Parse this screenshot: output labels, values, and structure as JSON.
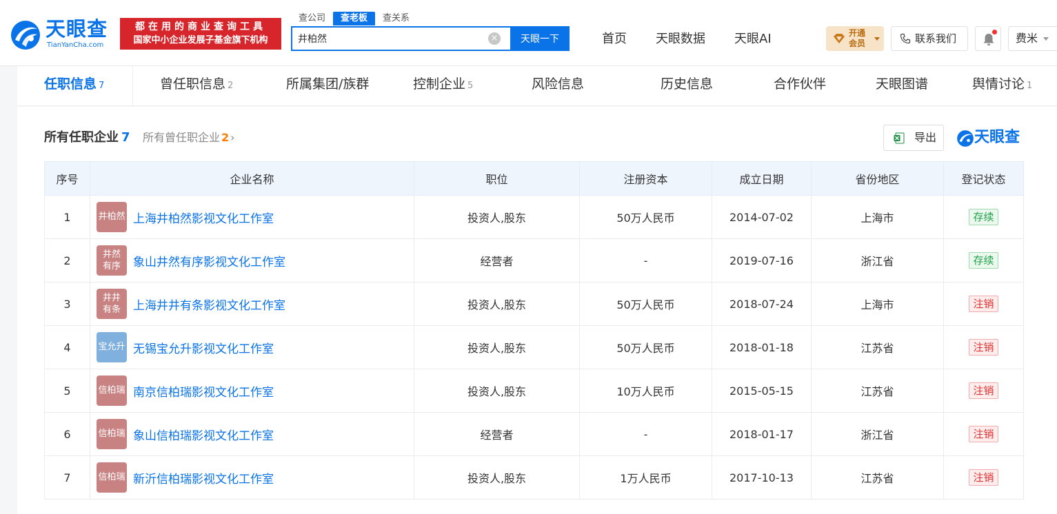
{
  "header": {
    "logo_cn": "天眼查",
    "logo_en": "TianYanCha.com",
    "slogan_line1": "都在用的商业查询工具",
    "slogan_line2": "国家中小企业发展子基金旗下机构",
    "search_tabs": [
      {
        "label": "查公司",
        "active": false
      },
      {
        "label": "查老板",
        "active": true
      },
      {
        "label": "查关系",
        "active": false
      }
    ],
    "search_value": "井柏然",
    "search_button": "天眼一下",
    "clear_glyph": "×",
    "nav": [
      "首页",
      "天眼数据",
      "天眼AI"
    ],
    "vip_label": "开通会员",
    "contact_label": "联系我们",
    "user_name": "费米"
  },
  "subtabs": [
    {
      "label": "任职信息",
      "count": "7",
      "active": true
    },
    {
      "label": "曾任职信息",
      "count": "2",
      "active": false
    },
    {
      "label": "所属集团/族群",
      "count": "",
      "active": false
    },
    {
      "label": "控制企业",
      "count": "5",
      "active": false
    },
    {
      "label": "风险信息",
      "count": "",
      "active": false
    },
    {
      "label": "历史信息",
      "count": "",
      "active": false
    },
    {
      "label": "合作伙伴",
      "count": "",
      "active": false
    },
    {
      "label": "天眼图谱",
      "count": "",
      "active": false
    },
    {
      "label": "舆情讨论",
      "count": "1",
      "active": false
    }
  ],
  "section": {
    "title": "所有任职企业",
    "count": "7",
    "former_label": "所有曾任职企业",
    "former_count": "2",
    "chevron": "›",
    "export_label": "导出",
    "brand_text": "天眼查"
  },
  "table": {
    "headers": [
      "序号",
      "企业名称",
      "职位",
      "注册资本",
      "成立日期",
      "省份地区",
      "登记状态"
    ],
    "rows": [
      {
        "no": "1",
        "avatar": [
          "井柏然"
        ],
        "avatar_color": "#c98282",
        "name": "上海井柏然影视文化工作室",
        "position": "投资人,股东",
        "capital": "50万人民币",
        "date": "2014-07-02",
        "region": "上海市",
        "status": "存续",
        "status_type": "ok"
      },
      {
        "no": "2",
        "avatar": [
          "井然",
          "有序"
        ],
        "avatar_color": "#c98282",
        "name": "象山井然有序影视文化工作室",
        "position": "经营者",
        "capital": "-",
        "date": "2019-07-16",
        "region": "浙江省",
        "status": "存续",
        "status_type": "ok"
      },
      {
        "no": "3",
        "avatar": [
          "井井",
          "有条"
        ],
        "avatar_color": "#c98282",
        "name": "上海井井有条影视文化工作室",
        "position": "投资人,股东",
        "capital": "50万人民币",
        "date": "2018-07-24",
        "region": "上海市",
        "status": "注销",
        "status_type": "bad"
      },
      {
        "no": "4",
        "avatar": [
          "宝允升"
        ],
        "avatar_color": "#7fb0de",
        "name": "无锡宝允升影视文化工作室",
        "position": "投资人,股东",
        "capital": "50万人民币",
        "date": "2018-01-18",
        "region": "江苏省",
        "status": "注销",
        "status_type": "bad"
      },
      {
        "no": "5",
        "avatar": [
          "信柏瑞"
        ],
        "avatar_color": "#c98282",
        "name": "南京信柏瑞影视文化工作室",
        "position": "投资人,股东",
        "capital": "10万人民币",
        "date": "2015-05-15",
        "region": "江苏省",
        "status": "注销",
        "status_type": "bad"
      },
      {
        "no": "6",
        "avatar": [
          "信柏瑞"
        ],
        "avatar_color": "#c98282",
        "name": "象山信柏瑞影视文化工作室",
        "position": "经营者",
        "capital": "-",
        "date": "2018-01-17",
        "region": "浙江省",
        "status": "注销",
        "status_type": "bad"
      },
      {
        "no": "7",
        "avatar": [
          "信柏瑞"
        ],
        "avatar_color": "#c98282",
        "name": "新沂信柏瑞影视文化工作室",
        "position": "投资人,股东",
        "capital": "1万人民币",
        "date": "2017-10-13",
        "region": "江苏省",
        "status": "注销",
        "status_type": "bad"
      }
    ]
  },
  "colors": {
    "brand_blue": "#0a73e8",
    "slogan_red": "#d7262b",
    "status_ok": "#20a14a",
    "status_bad": "#e0312f"
  },
  "icons": {
    "logo": "tianyancha-logo-icon",
    "clear": "clear-icon",
    "vip": "diamond-icon",
    "phone": "phone-icon",
    "bell": "bell-icon",
    "export": "excel-icon",
    "chevron": "chevron-right-icon"
  }
}
